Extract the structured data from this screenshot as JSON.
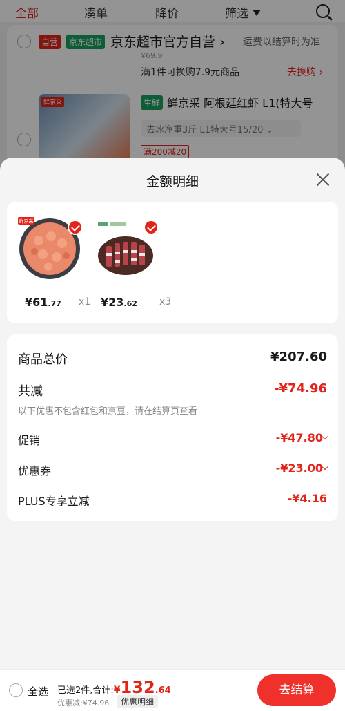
{
  "tabs": [
    {
      "label": "全部",
      "active": true
    },
    {
      "label": "凑单",
      "active": false
    },
    {
      "label": "降价",
      "active": false
    },
    {
      "label": "筛选",
      "active": false
    }
  ],
  "icons": {
    "search": "search-icon",
    "filter": "filter-icon",
    "close": "close-icon",
    "check": "check-icon",
    "chevron": "chevron-down-icon"
  },
  "store": {
    "tag_self": "自营",
    "tag_jd_supermarket": "京东超市",
    "name": "京东超市官方自营 ›",
    "shipping_note": "运费以结算时为准",
    "old_price": "¥69.9",
    "promo_line": "满1件可换购7.9元商品",
    "swap_link": "去换购 ›"
  },
  "product": {
    "thumb_brand": "鲜京采",
    "tag_fresh": "生鲜",
    "title": "鲜京采 阿根廷红虾 L1(特大号",
    "spec": "去冰净重3斤   L1特大号15/20 ⌄",
    "coupon_tag": "满200减20"
  },
  "sheet": {
    "title": "金额明细",
    "items": [
      {
        "name": "shrimp",
        "brand": "鲜京采",
        "price_int": "¥61",
        "price_dec": ".77",
        "qty": "x1"
      },
      {
        "name": "skewers",
        "price_int": "¥23",
        "price_dec": ".62",
        "qty": "x3"
      }
    ],
    "rows": {
      "total_label": "商品总价",
      "total_value": "¥207.60",
      "discount_label": "共减",
      "discount_value": "-¥74.96",
      "note": "以下优惠不包含红包和京豆，请在结算页查看",
      "promo_label": "促销",
      "promo_value": "-¥47.80",
      "coupon_label": "优惠券",
      "coupon_value": "-¥23.00",
      "plus_label": "PLUS专享立减",
      "plus_value": "-¥4.16"
    }
  },
  "checkout": {
    "select_all": "全选",
    "selected_text": "已选2件,合计:",
    "currency": "¥",
    "amount_int": "132",
    "amount_dec": ".64",
    "discount_line": "优惠减:¥74.96",
    "detail_chip": "优惠明细",
    "button": "去结算"
  },
  "colors": {
    "accent": "#e2231a",
    "green_tag": "#19a05e",
    "button": "#f0302a"
  }
}
